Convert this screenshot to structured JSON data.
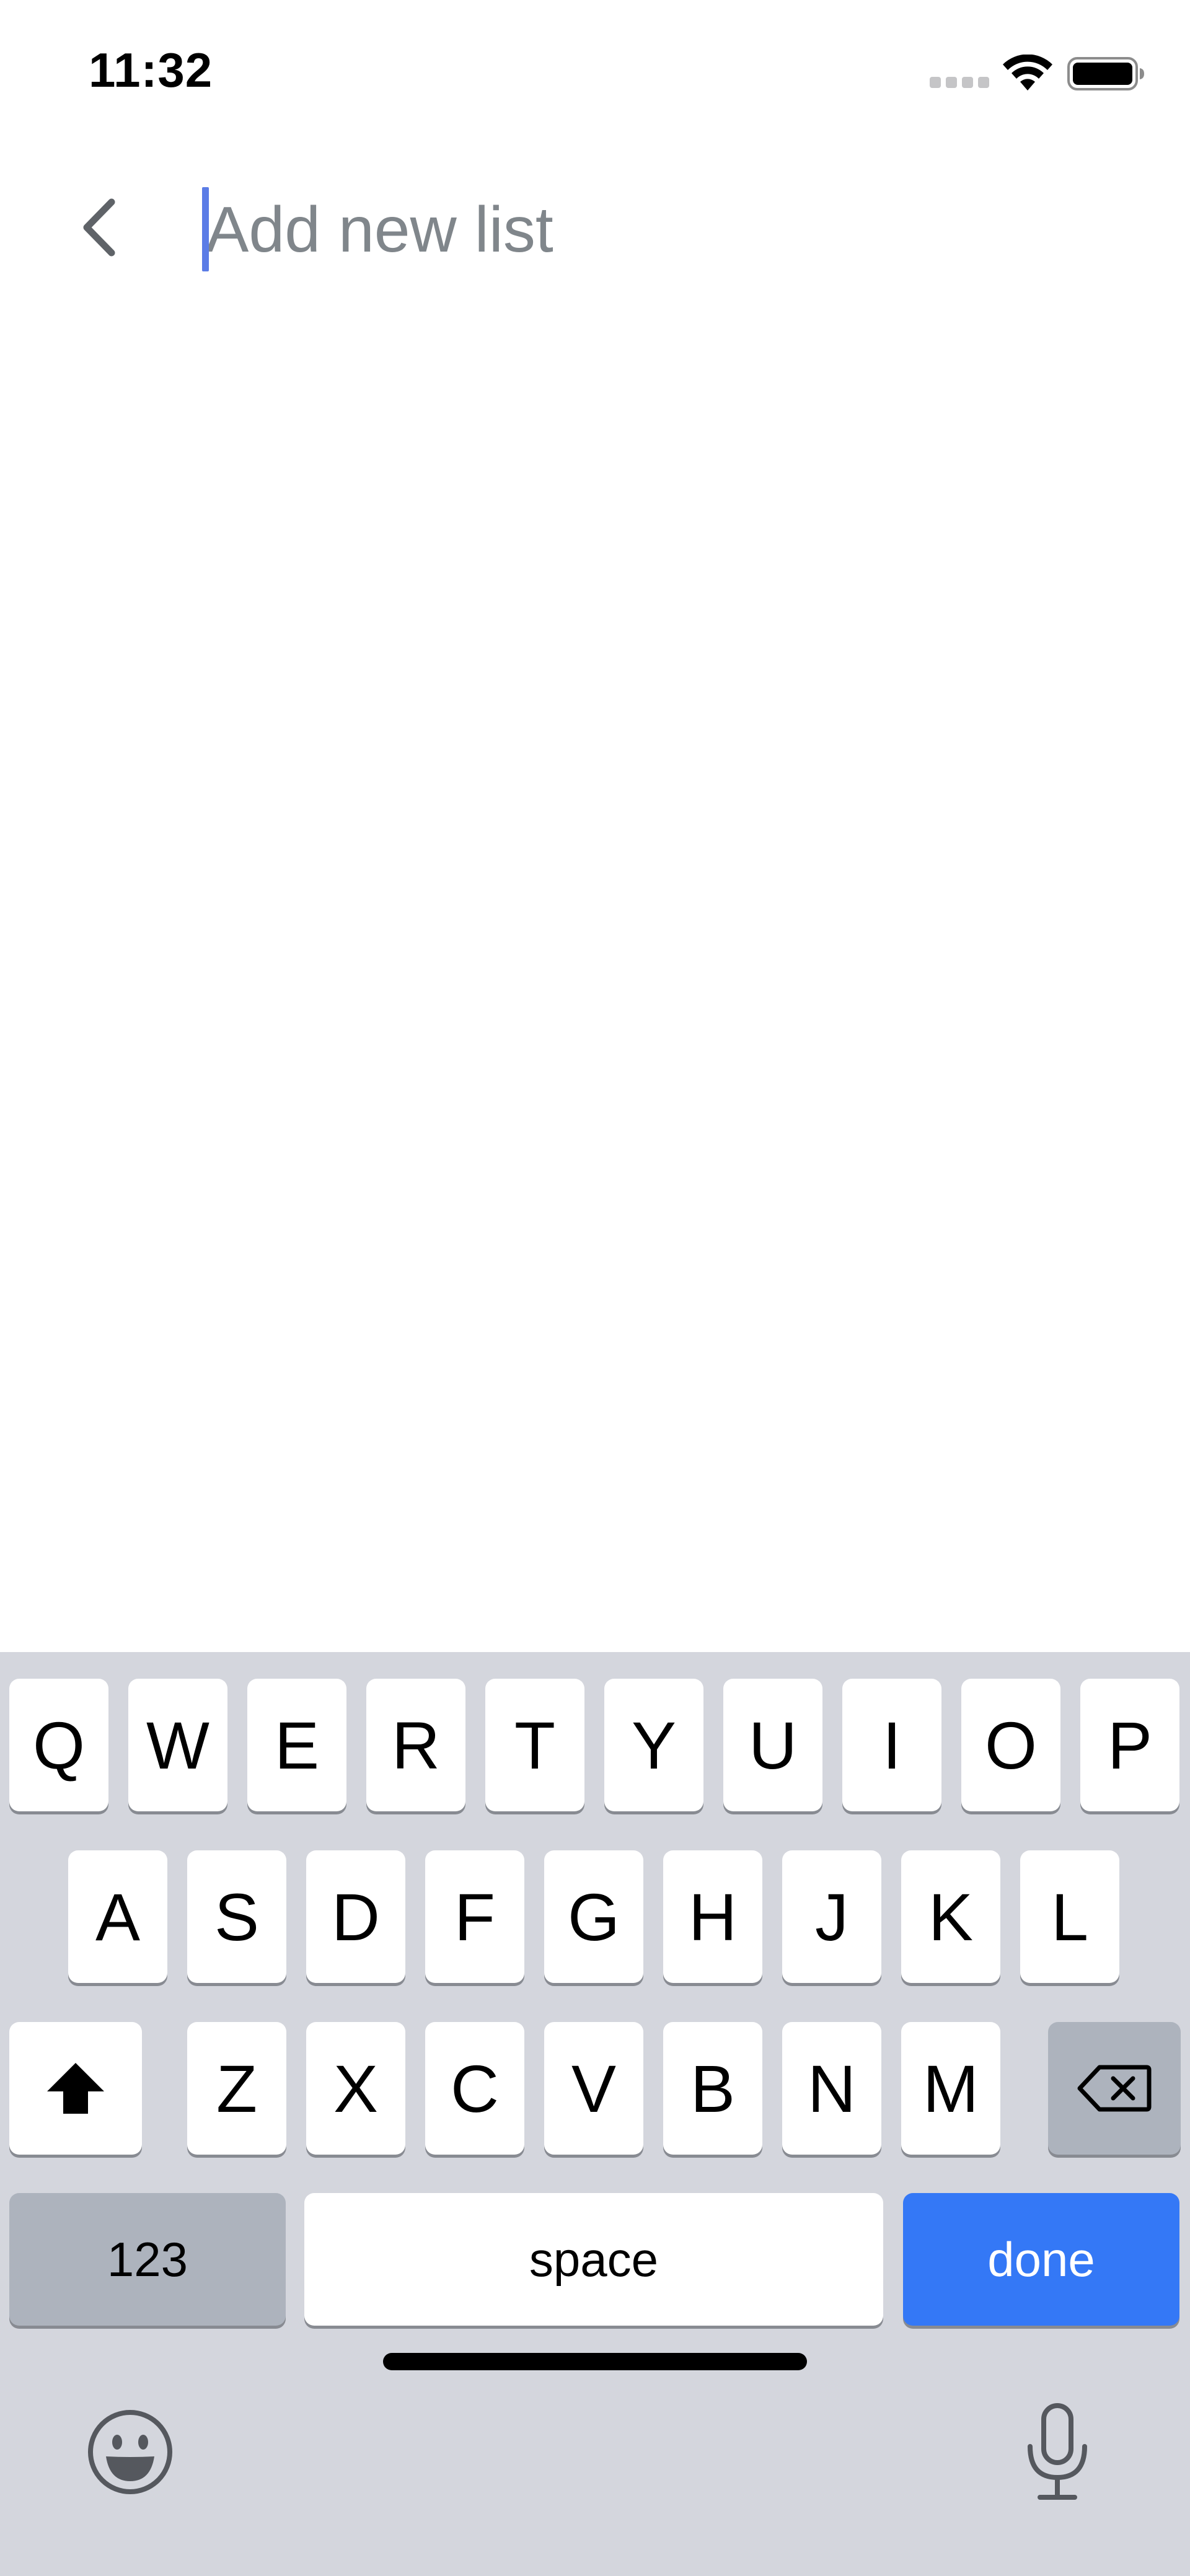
{
  "status_bar": {
    "time": "11:32",
    "icons": [
      "cellular-signal-icon",
      "wifi-icon",
      "battery-icon"
    ]
  },
  "header": {
    "back_icon": "chevron-left-icon",
    "title_input": {
      "value": "",
      "placeholder": "Add new list"
    }
  },
  "keyboard": {
    "row1": [
      "Q",
      "W",
      "E",
      "R",
      "T",
      "Y",
      "U",
      "I",
      "O",
      "P"
    ],
    "row2": [
      "A",
      "S",
      "D",
      "F",
      "G",
      "H",
      "J",
      "K",
      "L"
    ],
    "row3": [
      "Z",
      "X",
      "C",
      "V",
      "B",
      "N",
      "M"
    ],
    "shift_icon": "shift-arrow-icon",
    "delete_icon": "backspace-icon",
    "numbers_label": "123",
    "space_label": "space",
    "done_label": "done",
    "emoji_icon": "emoji-icon",
    "mic_icon": "microphone-icon"
  },
  "colors": {
    "caret": "#5b7ce6",
    "done_key": "#3478f6",
    "keyboard_bg": "#d4d6dd",
    "modifier_key": "#adb3bd"
  }
}
